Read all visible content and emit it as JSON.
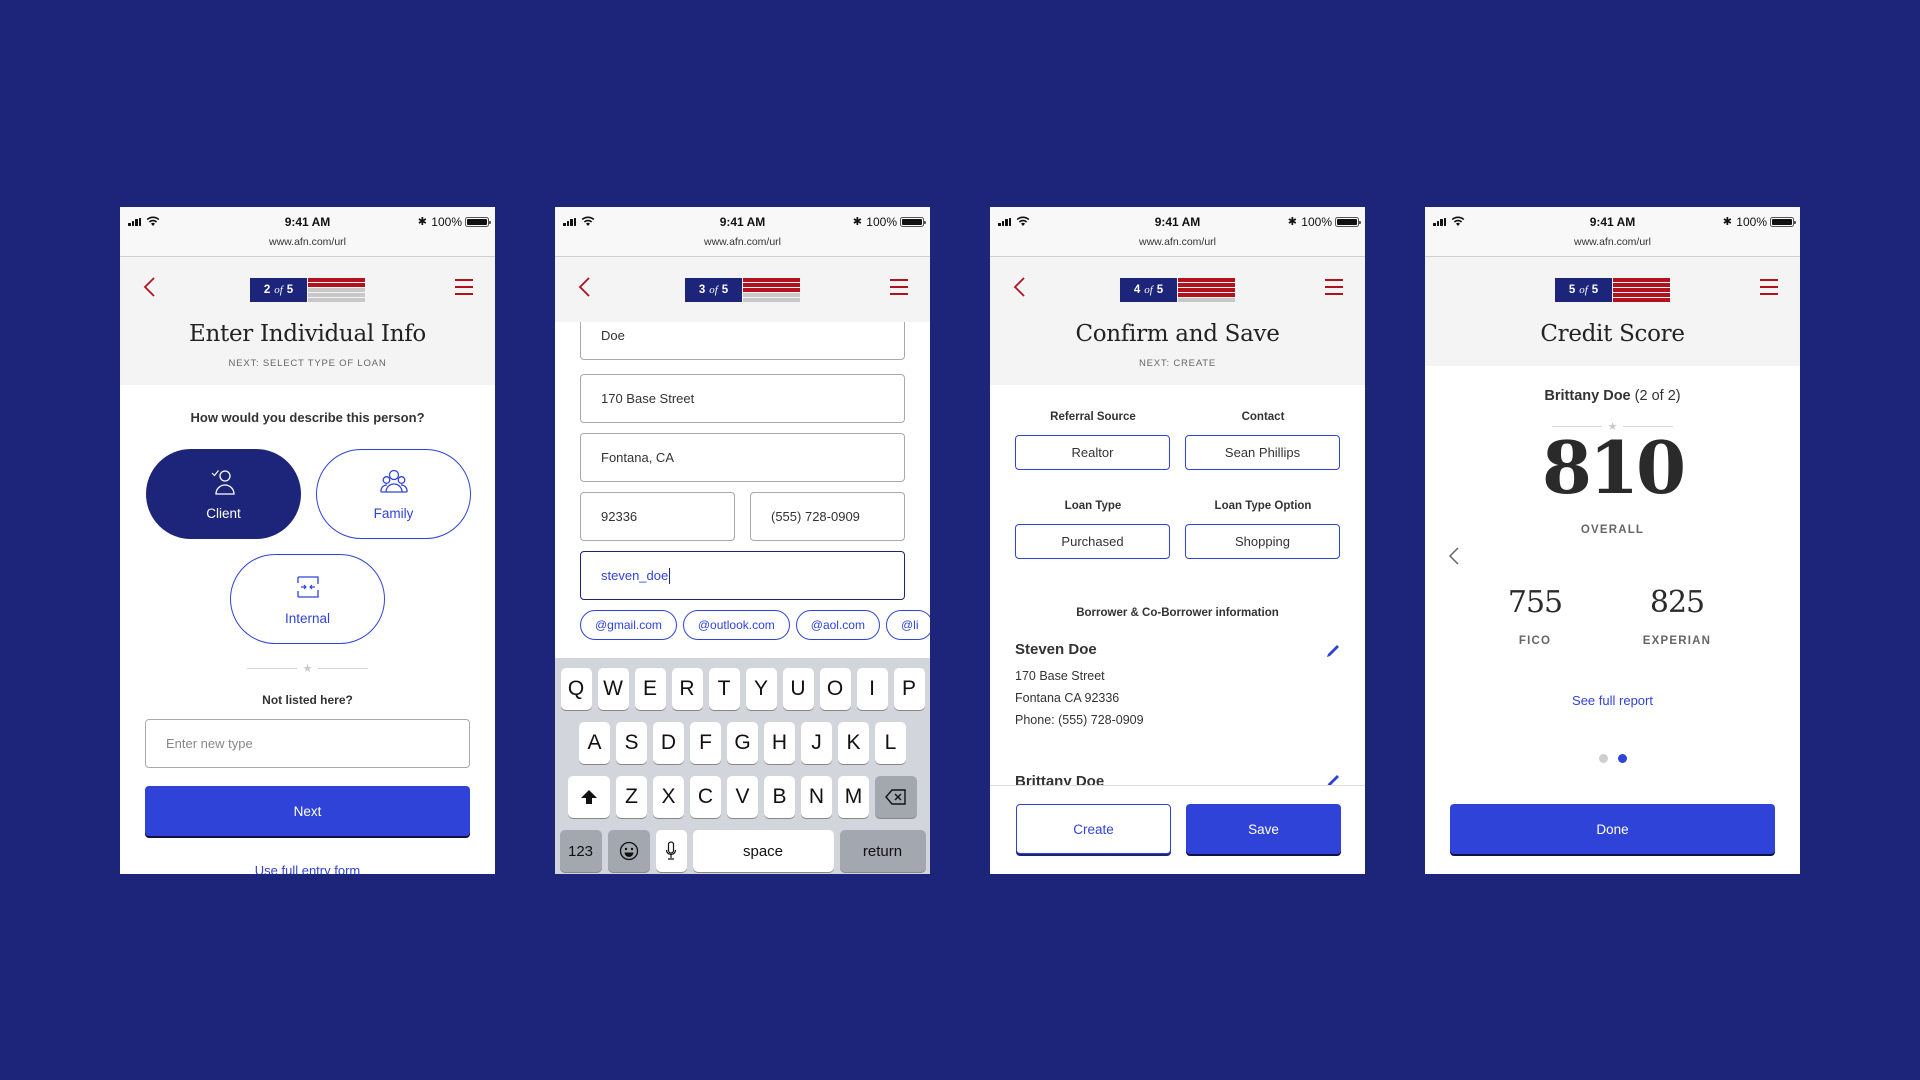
{
  "status_bar": {
    "time": "9:41 AM",
    "battery_pct": "100%",
    "bluetooth_icon": "bluetooth-icon",
    "url": "www.afn.com/url"
  },
  "colors": {
    "background": "#1c257a",
    "brand_navy": "#1c257a",
    "accent_blue": "#3043d9",
    "accent_red": "#b2121d",
    "progress_inactive": "#c8c8c8"
  },
  "screens": [
    {
      "progress": {
        "step": "2",
        "of": "of",
        "total": "5",
        "completed": 2,
        "steps": 5
      },
      "title": "Enter Individual Info",
      "subtitle": "NEXT: SELECT TYPE OF LOAN",
      "question": "How would you describe this person?",
      "options": [
        {
          "label": "Client",
          "icon": "person-check-icon",
          "selected": true
        },
        {
          "label": "Family",
          "icon": "group-icon",
          "selected": false
        },
        {
          "label": "Internal",
          "icon": "internal-transfer-icon",
          "selected": false
        }
      ],
      "not_listed": "Not listed here?",
      "new_type_placeholder": "Enter new type",
      "next_label": "Next",
      "full_entry_link": "Use full entry form"
    },
    {
      "progress": {
        "step": "3",
        "of": "of",
        "total": "5",
        "completed": 3,
        "steps": 5
      },
      "fields": {
        "last_name": "Doe",
        "street": "170 Base Street",
        "city_state": "Fontana, CA",
        "zip": "92336",
        "phone": "(555) 728-0909",
        "email": "steven_doe"
      },
      "email_suggestions": [
        "@gmail.com",
        "@outlook.com",
        "@aol.com",
        "@li"
      ],
      "keyboard": {
        "row1": [
          "Q",
          "W",
          "E",
          "R",
          "T",
          "Y",
          "U",
          "O",
          "I",
          "P"
        ],
        "row2": [
          "A",
          "S",
          "D",
          "F",
          "G",
          "H",
          "J",
          "K",
          "L"
        ],
        "row3": [
          "Z",
          "X",
          "C",
          "V",
          "B",
          "N",
          "M"
        ],
        "numbers_label": "123",
        "space_label": "space",
        "return_label": "return"
      }
    },
    {
      "progress": {
        "step": "4",
        "of": "of",
        "total": "5",
        "completed": 4,
        "steps": 5
      },
      "title": "Confirm and Save",
      "subtitle": "NEXT: CREATE",
      "referral_source_label": "Referral Source",
      "referral_source": "Realtor",
      "contact_label": "Contact",
      "contact": "Sean Phillips",
      "loan_type_label": "Loan Type",
      "loan_type": "Purchased",
      "loan_type_option_label": "Loan Type Option",
      "loan_type_option": "Shopping",
      "section_heading": "Borrower & Co-Borrower information",
      "borrowers": [
        {
          "name": "Steven Doe",
          "street": "170 Base Street",
          "city": "Fontana CA 92336",
          "phone": "Phone: (555) 728-0909"
        },
        {
          "name": "Brittany Doe"
        }
      ],
      "create_label": "Create",
      "save_label": "Save"
    },
    {
      "progress": {
        "step": "5",
        "of": "of",
        "total": "5",
        "completed": 5,
        "steps": 5
      },
      "title": "Credit Score",
      "borrower_name": "Brittany Doe",
      "borrower_index": "(2 of 2)",
      "overall_score": "810",
      "overall_label": "OVERALL",
      "fico_score": "755",
      "fico_label": "FICO",
      "experian_score": "825",
      "experian_label": "EXPERIAN",
      "full_report_link": "See full report",
      "page_dots": {
        "count": 2,
        "active": 2
      },
      "done_label": "Done"
    }
  ]
}
